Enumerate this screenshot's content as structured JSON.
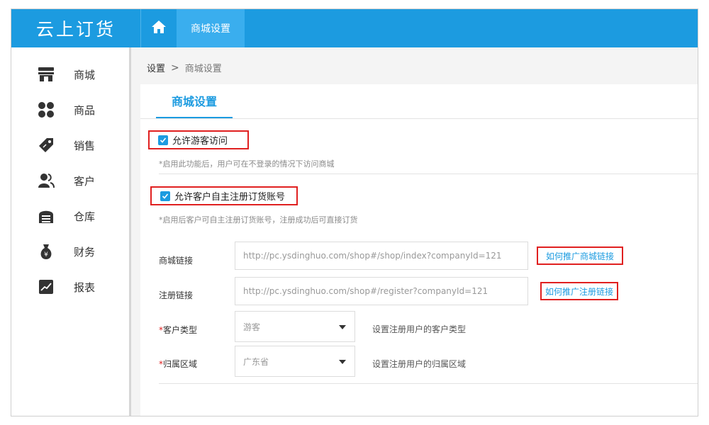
{
  "app": {
    "logo_text": "云上订货"
  },
  "topbar": {
    "active_tab": "商城设置",
    "accent": "#1c9be0"
  },
  "sidebar": {
    "items": [
      {
        "label": "商城",
        "icon": "store-icon"
      },
      {
        "label": "商品",
        "icon": "grid-icon"
      },
      {
        "label": "销售",
        "icon": "tag-icon"
      },
      {
        "label": "客户",
        "icon": "users-icon"
      },
      {
        "label": "仓库",
        "icon": "warehouse-icon"
      },
      {
        "label": "财务",
        "icon": "money-bag-icon"
      },
      {
        "label": "报表",
        "icon": "chart-icon"
      }
    ]
  },
  "breadcrumb": {
    "root": "设置",
    "separator": ">",
    "current": "商城设置"
  },
  "panel": {
    "tab_label": "商城设置"
  },
  "options": {
    "guest": {
      "label": "允许游客访问",
      "checked": true,
      "hint": "*启用此功能后，用户可在不登录的情况下访问商城"
    },
    "self_register": {
      "label": "允许客户自主注册订货账号",
      "checked": true,
      "hint": "*启用后客户可自主注册订货账号，注册成功后可直接订货"
    }
  },
  "form": {
    "shop_link": {
      "label": "商城链接",
      "value": "http://pc.ysdinghuo.com/shop#/shop/index?companyId=121",
      "help_link": "如何推广商城链接"
    },
    "register_link": {
      "label": "注册链接",
      "value": "http://pc.ysdinghuo.com/shop#/register?companyId=121",
      "help_link": "如何推广注册链接"
    },
    "customer_type": {
      "required_mark": "*",
      "label": "客户类型",
      "selected": "游客",
      "hint": "设置注册用户的客户类型"
    },
    "region": {
      "required_mark": "*",
      "label": "归属区域",
      "selected": "广东省",
      "hint": "设置注册用户的归属区域"
    }
  }
}
